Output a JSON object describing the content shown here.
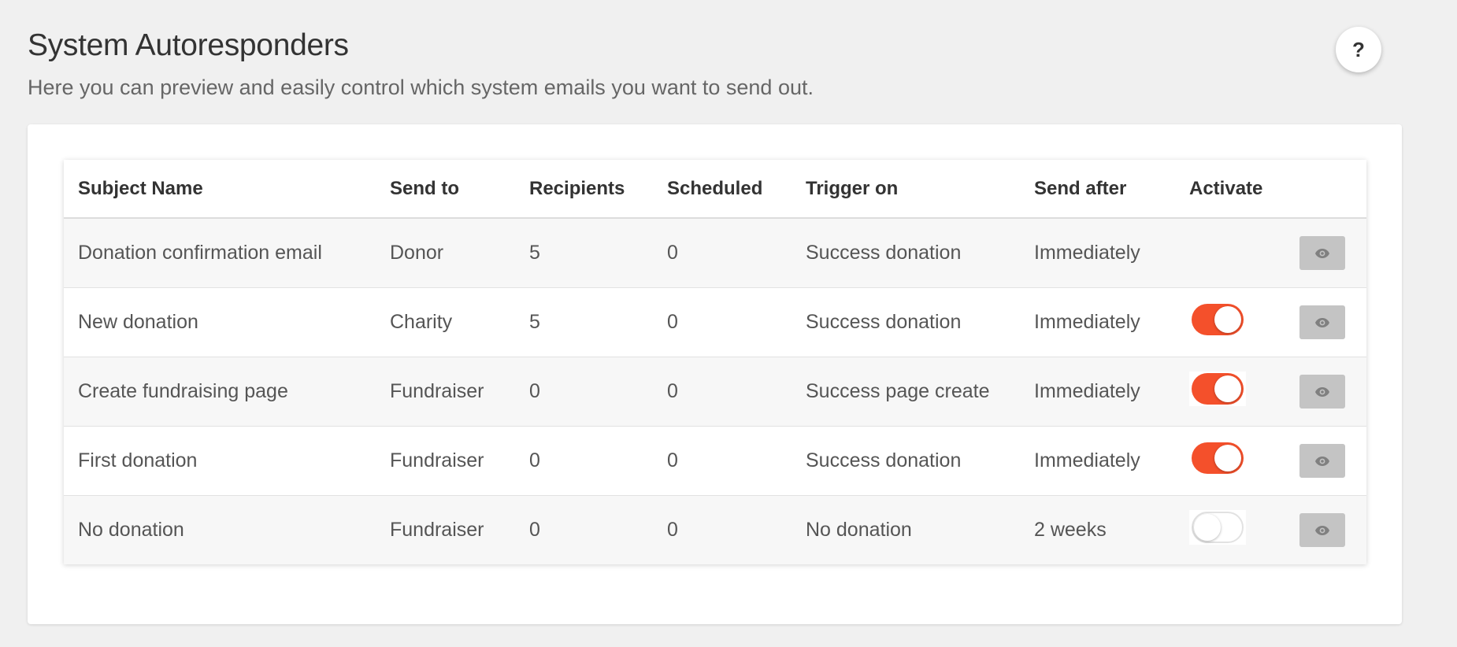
{
  "header": {
    "title": "System Autoresponders",
    "subtitle": "Here you can preview and easily control which system emails you want to send out.",
    "help_label": "?"
  },
  "table": {
    "columns": [
      "Subject Name",
      "Send to",
      "Recipients",
      "Scheduled",
      "Trigger on",
      "Send after",
      "Activate"
    ],
    "rows": [
      {
        "subject": "Donation confirmation email",
        "send_to": "Donor",
        "recipients": "5",
        "scheduled": "0",
        "trigger": "Success donation",
        "send_after": "Immediately",
        "activate": null
      },
      {
        "subject": "New donation",
        "send_to": "Charity",
        "recipients": "5",
        "scheduled": "0",
        "trigger": "Success donation",
        "send_after": "Immediately",
        "activate": true
      },
      {
        "subject": "Create fundraising page",
        "send_to": "Fundraiser",
        "recipients": "0",
        "scheduled": "0",
        "trigger": "Success page create",
        "send_after": "Immediately",
        "activate": true
      },
      {
        "subject": "First donation",
        "send_to": "Fundraiser",
        "recipients": "0",
        "scheduled": "0",
        "trigger": "Success donation",
        "send_after": "Immediately",
        "activate": true
      },
      {
        "subject": "No donation",
        "send_to": "Fundraiser",
        "recipients": "0",
        "scheduled": "0",
        "trigger": "No donation",
        "send_after": "2 weeks",
        "activate": false
      }
    ]
  },
  "icons": {
    "preview": "eye-icon",
    "help": "question-icon"
  },
  "colors": {
    "toggle_on": "#f4502b",
    "preview_button": "#c4c4c4",
    "background": "#f0f0f0"
  }
}
